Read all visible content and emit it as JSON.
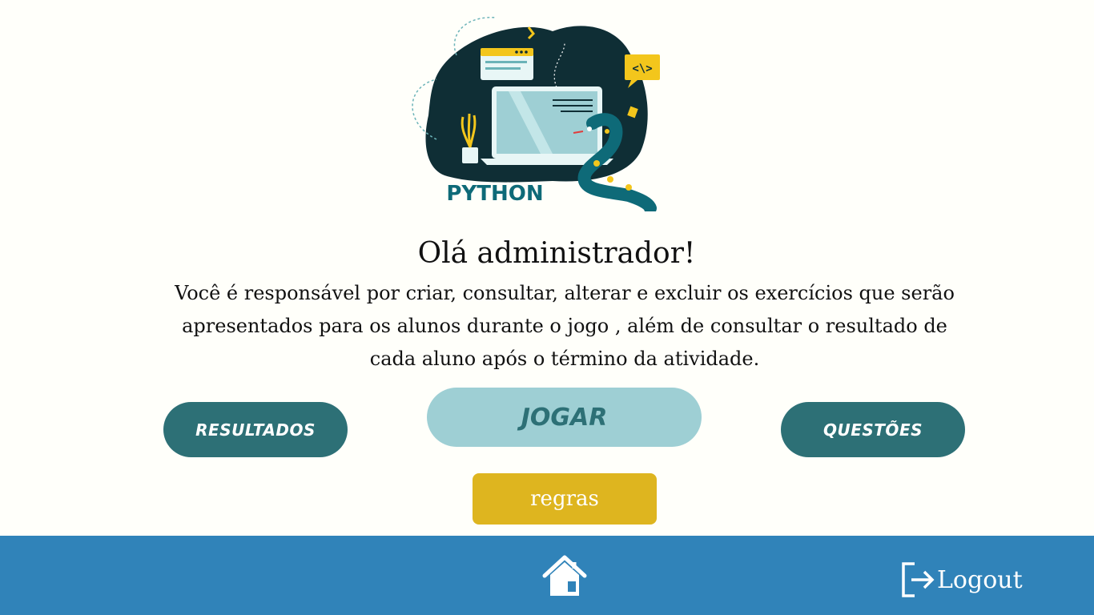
{
  "hero": {
    "logo_text": "PYTHON",
    "icon": "python-illustration-icon"
  },
  "greeting": "Olá administrador!",
  "description": "Você é responsável por criar, consultar, alterar e excluir os exercícios que serão apresentados para os alunos durante o jogo , além de consultar o resultado de cada aluno após o término da atividade.",
  "buttons": {
    "results": "RESULTADOS",
    "play": "JOGAR",
    "questions": "QUESTÕES",
    "rules": "regras"
  },
  "footer": {
    "home_icon": "home-icon",
    "logout_icon": "logout-icon",
    "logout_label": "Logout"
  },
  "colors": {
    "background": "#fffffa",
    "dark_teal": "#2d7076",
    "light_teal": "#9ecfd4",
    "gold": "#deb51f",
    "footer_blue": "#3083b9"
  }
}
